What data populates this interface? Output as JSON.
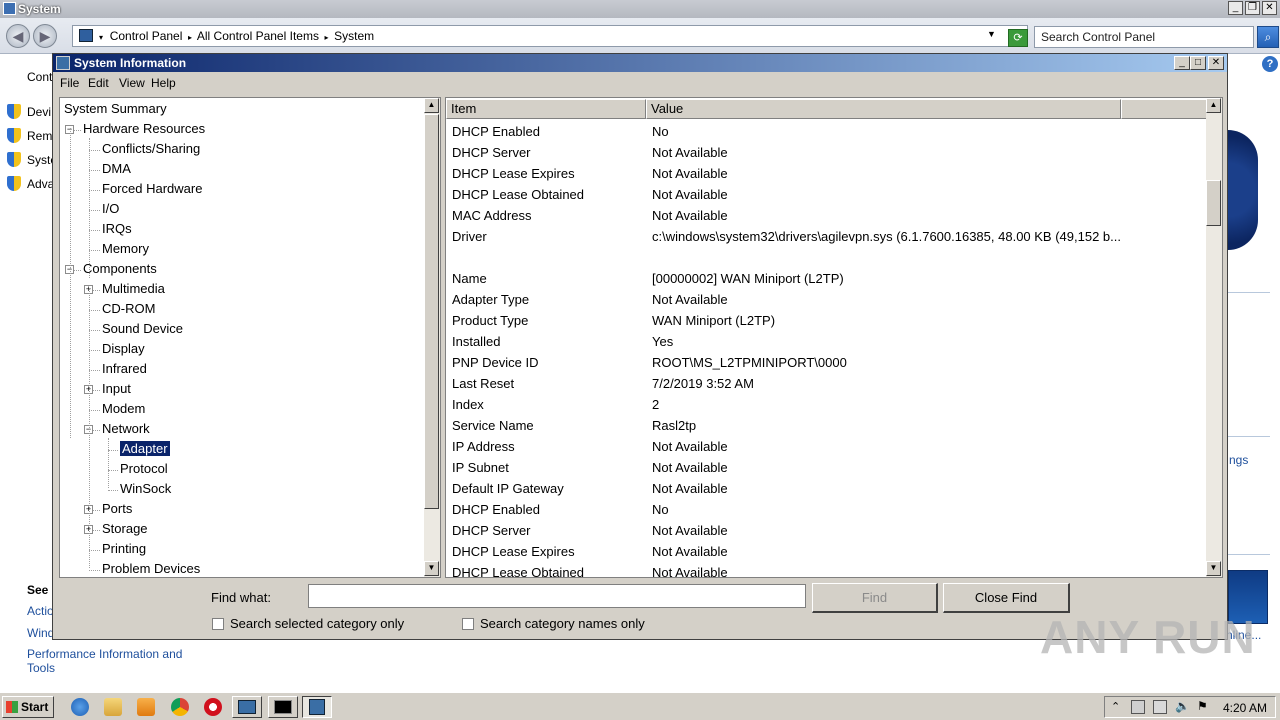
{
  "background_window": {
    "title": "System",
    "address_parts": [
      "Control Panel",
      "All Control Panel Items",
      "System"
    ],
    "search_placeholder": "Search Control Panel",
    "left_items": [
      "Cont",
      "Devi",
      "Remo",
      "Syste",
      "Adva"
    ],
    "see_also_heading": "See",
    "see_also_links": [
      "Actio",
      "Windo",
      "Performance Information and Tools"
    ],
    "right_fragments": [
      "ngs",
      "nline..."
    ]
  },
  "dialog": {
    "title": "System Information",
    "menu": [
      "File",
      "Edit",
      "View",
      "Help"
    ],
    "tree": [
      {
        "label": "System Summary",
        "level": 0,
        "expander": ""
      },
      {
        "label": "Hardware Resources",
        "level": 1,
        "expander": "-"
      },
      {
        "label": "Conflicts/Sharing",
        "level": 2,
        "expander": ""
      },
      {
        "label": "DMA",
        "level": 2,
        "expander": ""
      },
      {
        "label": "Forced Hardware",
        "level": 2,
        "expander": ""
      },
      {
        "label": "I/O",
        "level": 2,
        "expander": ""
      },
      {
        "label": "IRQs",
        "level": 2,
        "expander": ""
      },
      {
        "label": "Memory",
        "level": 2,
        "expander": ""
      },
      {
        "label": "Components",
        "level": 1,
        "expander": "-"
      },
      {
        "label": "Multimedia",
        "level": 2,
        "expander": "+"
      },
      {
        "label": "CD-ROM",
        "level": 2,
        "expander": ""
      },
      {
        "label": "Sound Device",
        "level": 2,
        "expander": ""
      },
      {
        "label": "Display",
        "level": 2,
        "expander": ""
      },
      {
        "label": "Infrared",
        "level": 2,
        "expander": ""
      },
      {
        "label": "Input",
        "level": 2,
        "expander": "+"
      },
      {
        "label": "Modem",
        "level": 2,
        "expander": ""
      },
      {
        "label": "Network",
        "level": 2,
        "expander": "-"
      },
      {
        "label": "Adapter",
        "level": 3,
        "expander": "",
        "selected": true
      },
      {
        "label": "Protocol",
        "level": 3,
        "expander": ""
      },
      {
        "label": "WinSock",
        "level": 3,
        "expander": ""
      },
      {
        "label": "Ports",
        "level": 2,
        "expander": "+"
      },
      {
        "label": "Storage",
        "level": 2,
        "expander": "+"
      },
      {
        "label": "Printing",
        "level": 2,
        "expander": ""
      },
      {
        "label": "Problem Devices",
        "level": 2,
        "expander": ""
      }
    ],
    "columns": [
      "Item",
      "Value"
    ],
    "rows": [
      {
        "item": "DHCP Enabled",
        "value": "No"
      },
      {
        "item": "DHCP Server",
        "value": "Not Available"
      },
      {
        "item": "DHCP Lease Expires",
        "value": "Not Available"
      },
      {
        "item": "DHCP Lease Obtained",
        "value": "Not Available"
      },
      {
        "item": "MAC Address",
        "value": "Not Available"
      },
      {
        "item": "Driver",
        "value": "c:\\windows\\system32\\drivers\\agilevpn.sys (6.1.7600.16385, 48.00 KB (49,152 b..."
      },
      {
        "item": "",
        "value": ""
      },
      {
        "item": "Name",
        "value": "[00000002] WAN Miniport (L2TP)"
      },
      {
        "item": "Adapter Type",
        "value": "Not Available"
      },
      {
        "item": "Product Type",
        "value": "WAN Miniport (L2TP)"
      },
      {
        "item": "Installed",
        "value": "Yes"
      },
      {
        "item": "PNP Device ID",
        "value": "ROOT\\MS_L2TPMINIPORT\\0000"
      },
      {
        "item": "Last Reset",
        "value": "7/2/2019 3:52 AM"
      },
      {
        "item": "Index",
        "value": "2"
      },
      {
        "item": "Service Name",
        "value": "Rasl2tp"
      },
      {
        "item": "IP Address",
        "value": "Not Available"
      },
      {
        "item": "IP Subnet",
        "value": "Not Available"
      },
      {
        "item": "Default IP Gateway",
        "value": "Not Available"
      },
      {
        "item": "DHCP Enabled",
        "value": "No"
      },
      {
        "item": "DHCP Server",
        "value": "Not Available"
      },
      {
        "item": "DHCP Lease Expires",
        "value": "Not Available"
      },
      {
        "item": "DHCP Lease Obtained",
        "value": "Not Available"
      }
    ],
    "find": {
      "label": "Find what:",
      "value": "",
      "find_button": "Find",
      "close_find_button": "Close Find",
      "check_selected_category": "Search selected category only",
      "check_category_names": "Search category names only"
    }
  },
  "taskbar": {
    "start_label": "Start",
    "clock": "4:20 AM"
  },
  "watermark": "ANY RUN"
}
